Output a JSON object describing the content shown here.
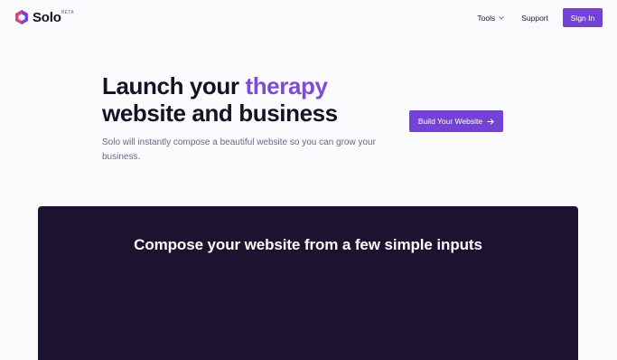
{
  "nav": {
    "brand": "Solo",
    "badge": "BETA",
    "links": [
      {
        "label": "Tools"
      },
      {
        "label": "Support"
      }
    ],
    "signin_label": "Sign In"
  },
  "hero": {
    "title_part1": "Launch your ",
    "title_accent": "therapy",
    "title_part2": "website and business",
    "subtitle": "Solo will instantly compose a beautiful website so you can grow your business.",
    "cta_label": "Build Your Website"
  },
  "panel": {
    "title": "Compose your website from a few simple inputs"
  },
  "colors": {
    "accent": "#7443d6",
    "background": "#fbfafd",
    "panel": "#1d1330",
    "text": "#161224"
  },
  "icons": [
    "solo-logo-icon",
    "chevron-down-icon",
    "arrow-right-icon"
  ]
}
